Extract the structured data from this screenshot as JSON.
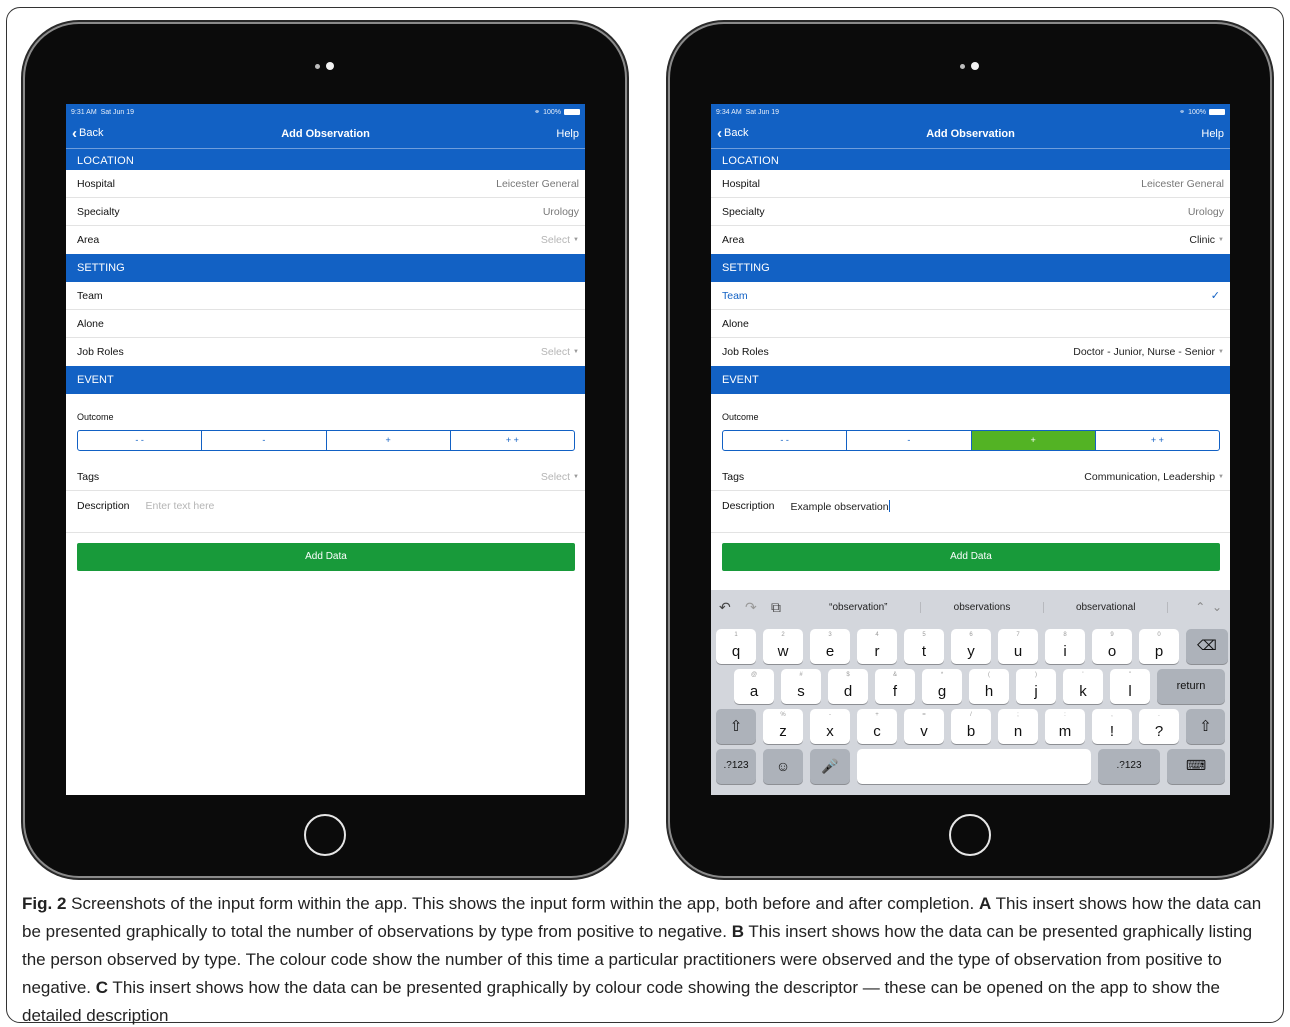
{
  "left_screen": {
    "status": {
      "time": "9:31 AM",
      "date": "Sat Jun 19",
      "battery": "100%"
    },
    "nav": {
      "back": "Back",
      "title": "Add Observation",
      "help": "Help"
    },
    "location": {
      "header": "LOCATION",
      "hospital_label": "Hospital",
      "hospital_value": "Leicester General",
      "specialty_label": "Specialty",
      "specialty_value": "Urology",
      "area_label": "Area",
      "area_value": "Select"
    },
    "setting": {
      "header": "SETTING",
      "team": "Team",
      "alone": "Alone",
      "job_roles_label": "Job Roles",
      "job_roles_value": "Select"
    },
    "event": {
      "header": "EVENT",
      "outcome_label": "Outcome",
      "outcomes": [
        "- -",
        "-",
        "+",
        "+ +"
      ],
      "tags_label": "Tags",
      "tags_value": "Select",
      "description_label": "Description",
      "description_placeholder": "Enter text here"
    },
    "add_data": "Add Data"
  },
  "right_screen": {
    "status": {
      "time": "9:34 AM",
      "date": "Sat Jun 19",
      "battery": "100%"
    },
    "nav": {
      "back": "Back",
      "title": "Add Observation",
      "help": "Help"
    },
    "location": {
      "header": "LOCATION",
      "hospital_label": "Hospital",
      "hospital_value": "Leicester General",
      "specialty_label": "Specialty",
      "specialty_value": "Urology",
      "area_label": "Area",
      "area_value": "Clinic"
    },
    "setting": {
      "header": "SETTING",
      "team": "Team",
      "alone": "Alone",
      "job_roles_label": "Job Roles",
      "job_roles_value": "Doctor - Junior, Nurse - Senior"
    },
    "event": {
      "header": "EVENT",
      "outcome_label": "Outcome",
      "outcomes": [
        "- -",
        "-",
        "+",
        "+ +"
      ],
      "selected_outcome": "+",
      "tags_label": "Tags",
      "tags_value": "Communication, Leadership",
      "description_label": "Description",
      "description_value": "Example observation"
    },
    "add_data": "Add Data",
    "keyboard": {
      "suggestions": [
        "“observation”",
        "observations",
        "observational"
      ],
      "row1": [
        {
          "k": "q",
          "s": "1"
        },
        {
          "k": "w",
          "s": "2"
        },
        {
          "k": "e",
          "s": "3"
        },
        {
          "k": "r",
          "s": "4"
        },
        {
          "k": "t",
          "s": "5"
        },
        {
          "k": "y",
          "s": "6"
        },
        {
          "k": "u",
          "s": "7"
        },
        {
          "k": "i",
          "s": "8"
        },
        {
          "k": "o",
          "s": "9"
        },
        {
          "k": "p",
          "s": "0"
        }
      ],
      "row2": [
        {
          "k": "a",
          "s": "@"
        },
        {
          "k": "s",
          "s": "#"
        },
        {
          "k": "d",
          "s": "$"
        },
        {
          "k": "f",
          "s": "&"
        },
        {
          "k": "g",
          "s": "*"
        },
        {
          "k": "h",
          "s": "("
        },
        {
          "k": "j",
          "s": ")"
        },
        {
          "k": "k",
          "s": "'"
        },
        {
          "k": "l",
          "s": "\""
        }
      ],
      "row3": [
        {
          "k": "z",
          "s": "%"
        },
        {
          "k": "x",
          "s": "-"
        },
        {
          "k": "c",
          "s": "+"
        },
        {
          "k": "v",
          "s": "="
        },
        {
          "k": "b",
          "s": "/"
        },
        {
          "k": "n",
          "s": ";"
        },
        {
          "k": "m",
          "s": ":"
        },
        {
          "k": "!",
          "s": ","
        },
        {
          "k": "?",
          "s": "."
        }
      ],
      "return": "return",
      "numbers": ".?123"
    }
  },
  "caption": {
    "fig_label": "Fig. 2",
    "text1": " Screenshots of the input form within the app. This shows the input form within the app, both before and after completion. ",
    "a_label": "A",
    "text2": " This insert shows how the data can be presented graphically to total the number of observations by type from positive to negative. ",
    "b_label": "B",
    "text3": " This insert shows how the data can be presented graphically listing the person observed by type. The colour code show the number of this time a particular practitioners were observed and the type of observation from positive to negative. ",
    "c_label": "C",
    "text4": " This insert shows how the data can be presented graphically by colour code showing the descriptor — these can be opened on the app to show the detailed description"
  },
  "colors": {
    "nav_blue": "#1261c4",
    "button_green": "#189a3a",
    "selected_green": "#53b324"
  }
}
